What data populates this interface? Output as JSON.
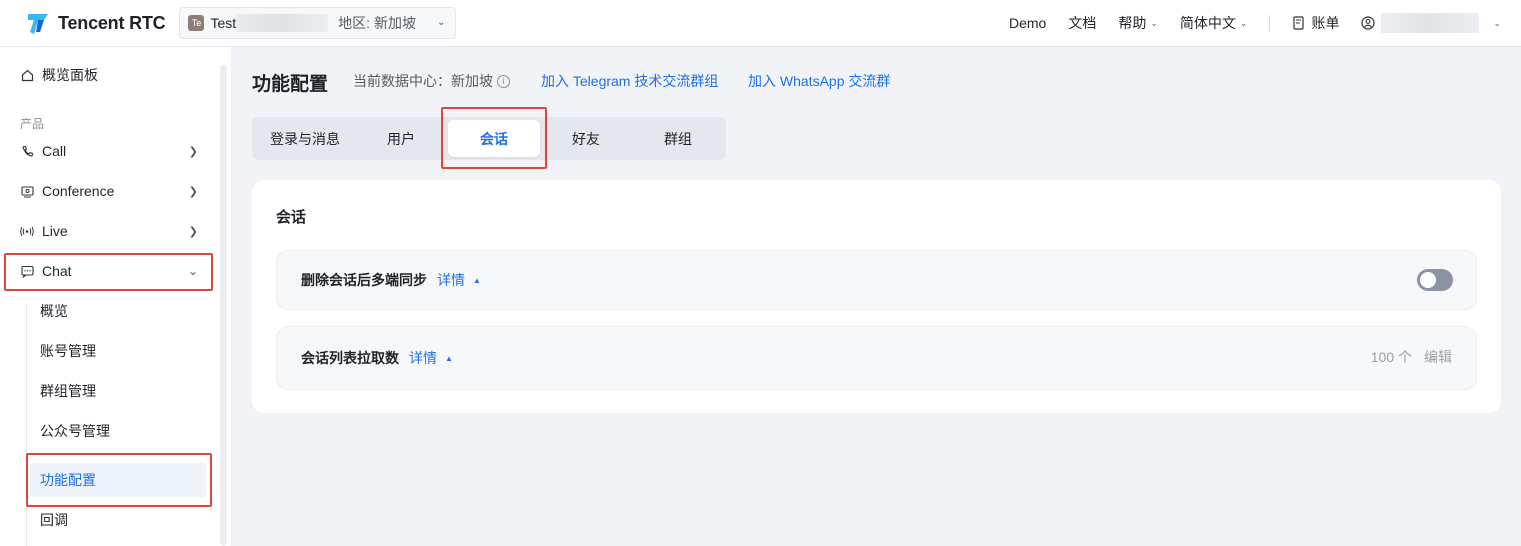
{
  "colors": {
    "accent": "#1f6fe8",
    "highlight": "#e0453d",
    "logo_light": "#39b7f5",
    "logo_dark": "#1a63d6"
  },
  "header": {
    "brand": "Tencent RTC",
    "app": {
      "avatar": "Te",
      "name": "Test",
      "region": "地区: 新加坡"
    },
    "links": {
      "demo": "Demo",
      "docs": "文档",
      "help": "帮助",
      "language": "简体中文",
      "billing": "账单"
    },
    "icons": {
      "billing": "bill-icon",
      "user": "user-icon"
    }
  },
  "sidebar": {
    "overview": "概览面板",
    "section_label": "产品",
    "products": [
      {
        "label": "Call",
        "icon": "phone-icon"
      },
      {
        "label": "Conference",
        "icon": "conference-icon"
      },
      {
        "label": "Live",
        "icon": "live-icon"
      },
      {
        "label": "Chat",
        "icon": "chat-icon"
      }
    ],
    "chat_sub": [
      "概览",
      "账号管理",
      "群组管理",
      "公众号管理",
      "功能配置",
      "回调"
    ]
  },
  "main": {
    "title": "功能配置",
    "data_center": "当前数据中心：新加坡",
    "link_telegram": "加入 Telegram 技术交流群组",
    "link_whatsapp": "加入 WhatsApp 交流群",
    "tabs": [
      "登录与消息",
      "用户",
      "会话",
      "好友",
      "群组"
    ],
    "active_tab": "会话",
    "card": {
      "title": "会话",
      "rows": [
        {
          "label": "删除会话后多端同步",
          "detail": "详情",
          "toggle": "off"
        },
        {
          "label": "会话列表拉取数",
          "detail": "详情",
          "value": "100 个",
          "action": "编辑"
        }
      ]
    }
  }
}
